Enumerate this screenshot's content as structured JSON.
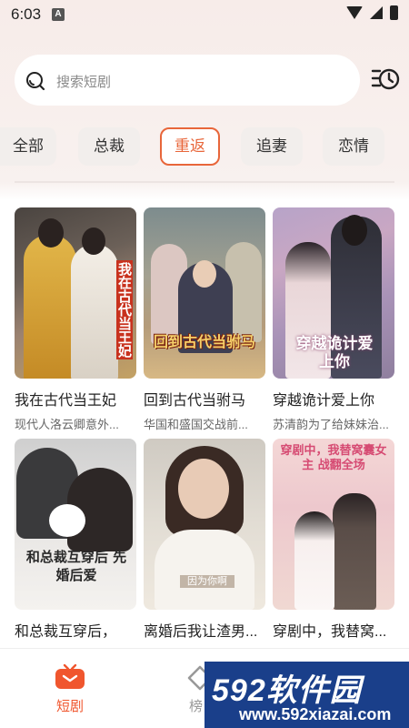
{
  "status_bar": {
    "time": "6:03",
    "notification_letter": "A"
  },
  "search": {
    "placeholder": "搜索短剧"
  },
  "tabs": [
    {
      "label": "全部",
      "active": false
    },
    {
      "label": "总裁",
      "active": false
    },
    {
      "label": "重返",
      "active": true
    },
    {
      "label": "追妻",
      "active": false
    },
    {
      "label": "恋情",
      "active": false
    }
  ],
  "dramas": [
    {
      "title": "我在古代当王妃",
      "desc": "现代人洛云卿意外...",
      "poster_text": "我在古代当王妃"
    },
    {
      "title": "回到古代当驸马",
      "desc": "华国和盛国交战前...",
      "poster_text": "回到古代当驸马"
    },
    {
      "title": "穿越诡计爱上你",
      "desc": "苏清韵为了给妹妹治...",
      "poster_text": "穿越诡计爱上你"
    },
    {
      "title": "和总裁互穿后，",
      "desc": "",
      "poster_text": "和总裁互穿后 先婚后爱"
    },
    {
      "title": "离婚后我让渣男...",
      "desc": "",
      "poster_text": "因为你啊"
    },
    {
      "title": "穿剧中，我替窝...",
      "desc": "",
      "poster_text": "穿剧中，我替窝囊女主 战翻全场"
    }
  ],
  "bottom_nav": [
    {
      "label": "短剧",
      "active": true
    },
    {
      "label": "榜",
      "active": false
    }
  ],
  "watermark": {
    "brand": "592软件园",
    "url": "www.592xiazai.com"
  },
  "colors": {
    "accent": "#e8663a",
    "watermark_bg": "#1a3f8a"
  }
}
